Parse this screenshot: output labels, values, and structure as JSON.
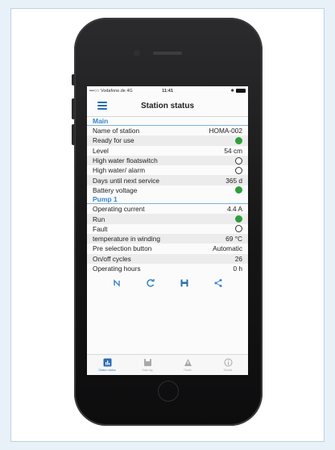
{
  "statusbar": {
    "carrier": "•••○○ Vodafone.de  4G",
    "time": "11:41",
    "bt": "✱"
  },
  "header": {
    "title": "Station status"
  },
  "sections": [
    {
      "title": "Main",
      "rows": [
        {
          "label": "Name of station",
          "value": "HOMA-002",
          "indicator": "none"
        },
        {
          "label": "Ready for use",
          "value": "",
          "indicator": "on"
        },
        {
          "label": "Level",
          "value": "54 cm",
          "indicator": "none"
        },
        {
          "label": "High water floatswitch",
          "value": "",
          "indicator": "off"
        },
        {
          "label": "High water/ alarm",
          "value": "",
          "indicator": "off"
        },
        {
          "label": "Days until next service",
          "value": "365 d",
          "indicator": "none"
        },
        {
          "label": "Battery voltage",
          "value": "",
          "indicator": "on"
        }
      ]
    },
    {
      "title": "Pump 1",
      "rows": [
        {
          "label": "Operating current",
          "value": "4.4 A",
          "indicator": "none"
        },
        {
          "label": "Run",
          "value": "",
          "indicator": "on"
        },
        {
          "label": "Fault",
          "value": "",
          "indicator": "off"
        },
        {
          "label": "temperature in winding",
          "value": "69 °C",
          "indicator": "none"
        },
        {
          "label": "Pre selection button",
          "value": "Automatic",
          "indicator": "none"
        },
        {
          "label": "On/off cycles",
          "value": "26",
          "indicator": "none"
        },
        {
          "label": "Operating hours",
          "value": "0 h",
          "indicator": "none"
        }
      ]
    }
  ],
  "actions": [
    "sync-icon",
    "refresh-icon",
    "save-icon",
    "share-icon"
  ],
  "tabs": [
    {
      "icon": "chart-icon",
      "label": "Station status",
      "active": true
    },
    {
      "icon": "disk-icon",
      "label": "Data log",
      "active": false
    },
    {
      "icon": "warning-icon",
      "label": "Faults",
      "active": false
    },
    {
      "icon": "info-icon",
      "label": "Details",
      "active": false
    }
  ],
  "colors": {
    "accent": "#3a86c8",
    "on": "#2e9e3c",
    "phone": "#151516"
  }
}
